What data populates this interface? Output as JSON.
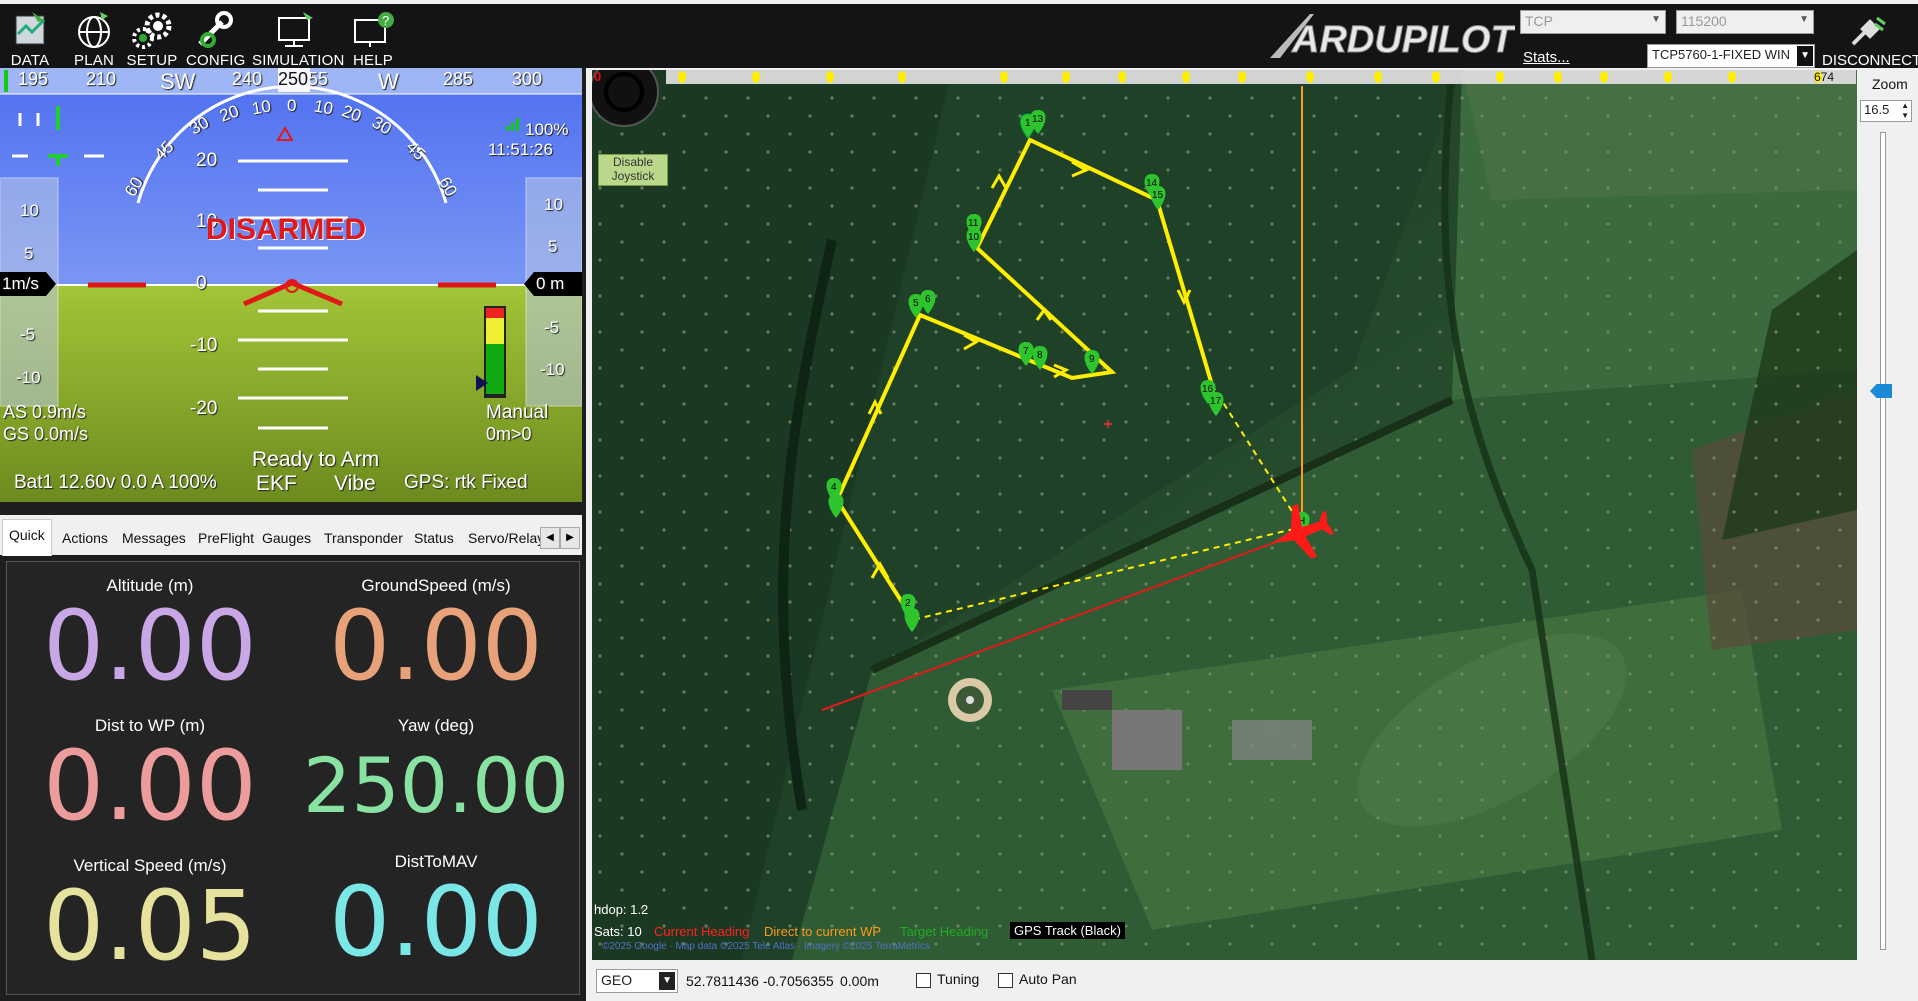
{
  "toolbar": {
    "buttons": [
      {
        "label": "DATA",
        "icon": "data-icon"
      },
      {
        "label": "PLAN",
        "icon": "globe-icon"
      },
      {
        "label": "SETUP",
        "icon": "gears-icon"
      },
      {
        "label": "CONFIG",
        "icon": "wrench-icon"
      },
      {
        "label": "SIMULATION",
        "icon": "monitor-icon"
      },
      {
        "label": "HELP",
        "icon": "help-monitor-icon"
      }
    ],
    "logo_text": "ARDUPILOT",
    "connection_type": "TCP",
    "baud": "115200",
    "stats_link": "Stats...",
    "vehicle_select": "TCP5760-1-FIXED WIN",
    "disconnect_label": "DISCONNECT"
  },
  "hud": {
    "heading_ticks": [
      "195",
      "210",
      "SW",
      "240",
      "250",
      "55",
      "W",
      "285",
      "300"
    ],
    "heading_value": "250",
    "roll_marks": [
      "60",
      "45",
      "30",
      "20",
      "10",
      "0",
      "10",
      "20",
      "30",
      "45",
      "60"
    ],
    "pitch_marks": [
      "20",
      "10",
      "0",
      "-10",
      "-20"
    ],
    "speed_tape": [
      "10",
      "5",
      "0",
      "-5",
      "-10"
    ],
    "alt_tape": [
      "10",
      "5",
      "-5",
      "-10"
    ],
    "speed_box": "1m/s",
    "alt_box": "0 m",
    "status": "DISARMED",
    "link_quality": "100%",
    "time": "11:51:26",
    "airspeed": "AS 0.9m/s",
    "groundspeed": "GS 0.0m/s",
    "mode": "Manual",
    "wp_info": "0m>0",
    "ready": "Ready to Arm",
    "battery": "Bat1 12.60v 0.0 A 100%",
    "ekf": "EKF",
    "vibe": "Vibe",
    "gps": "GPS: rtk Fixed",
    "colors": {
      "sky": "#5a7cf0",
      "ground": "#95b830",
      "disarmed": "#e01818"
    }
  },
  "tabs": [
    "Quick",
    "Actions",
    "Messages",
    "PreFlight",
    "Gauges",
    "Transponder",
    "Status",
    "Servo/Relay"
  ],
  "active_tab": "Quick",
  "quick": [
    {
      "label": "Altitude (m)",
      "value": "0.00",
      "color": "#c9a7e6"
    },
    {
      "label": "GroundSpeed (m/s)",
      "value": "0.00",
      "color": "#e8a27a"
    },
    {
      "label": "Dist to WP (m)",
      "value": "0.00",
      "color": "#ec9c9c"
    },
    {
      "label": "Yaw (deg)",
      "value": "250.00",
      "color": "#88e2a2"
    },
    {
      "label": "Vertical Speed (m/s)",
      "value": "0.05",
      "color": "#e6e29e"
    },
    {
      "label": "DistToMAV",
      "value": "0.00",
      "color": "#7ae6e6"
    }
  ],
  "map": {
    "joystick_button": "Disable Joystick",
    "timeline_start": "0",
    "timeline_end": "674",
    "zoom_label": "Zoom",
    "zoom_value": "16.5",
    "hdop": "hdop: 1.2",
    "sats": "Sats: 10",
    "legend": [
      {
        "text": "Current Heading",
        "color": "#ff2020"
      },
      {
        "text": "Direct to current WP",
        "color": "#ff9a1a"
      },
      {
        "text": "Target Heading",
        "color": "#22aa22"
      },
      {
        "text": "GPS Track (Black)",
        "color": "#ffffff"
      }
    ],
    "attribution": "©2025 Google · Map data ©2025 Tele Atlas · Imagery ©2025 TerraMetrics",
    "waypoints": [
      "1",
      "2",
      "4",
      "5",
      "6",
      "7",
      "8",
      "9",
      "10",
      "11",
      "12",
      "13",
      "14",
      "15",
      "16",
      "17"
    ],
    "home_marker": "H"
  },
  "bottom": {
    "coord_system": "GEO",
    "coords": "52.7811436 -0.7056355",
    "alt": "0.00m",
    "tuning_label": "Tuning",
    "autopan_label": "Auto Pan"
  }
}
